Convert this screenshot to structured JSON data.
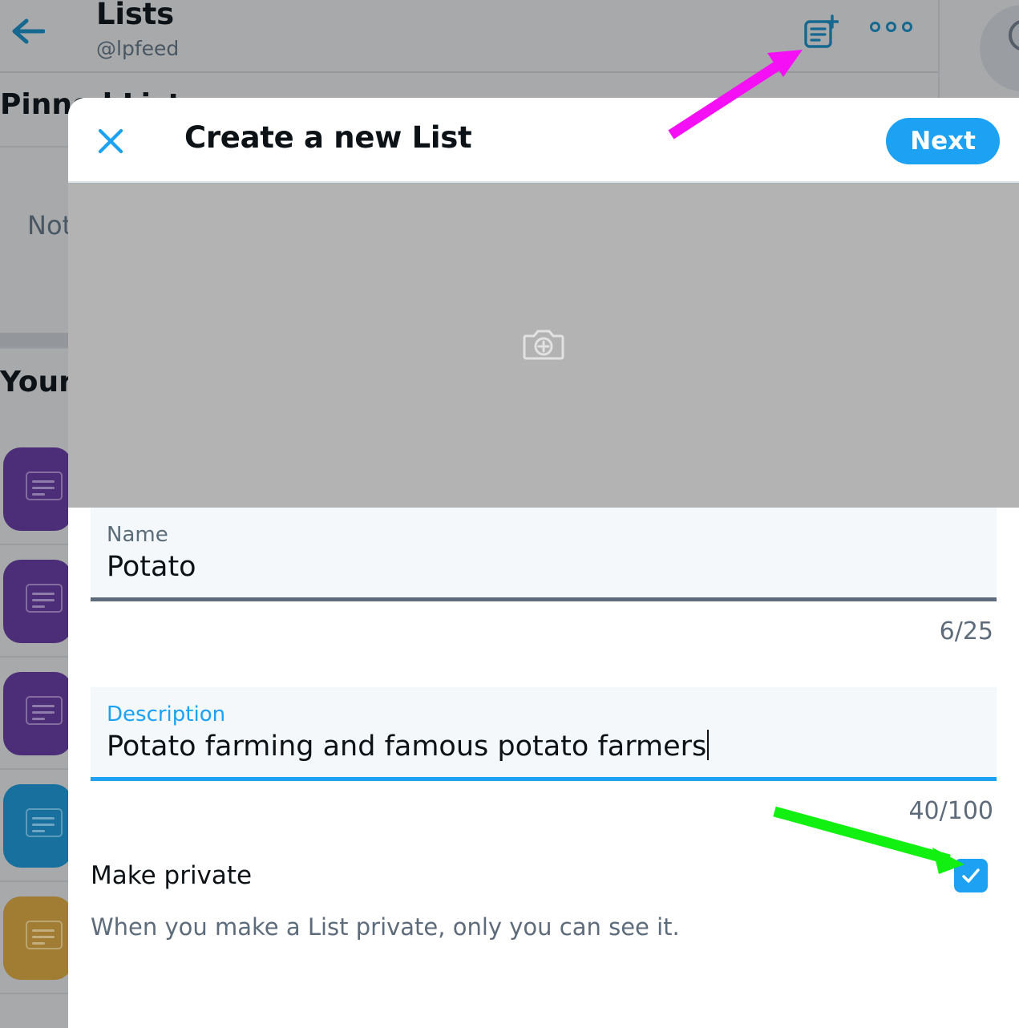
{
  "background": {
    "back_icon": "back-arrow-icon",
    "title": "Lists",
    "handle": "@lpfeed",
    "new_list_icon": "new-list-icon",
    "more_icon": "more-options-icon",
    "pinned_heading": "Pinned Lists",
    "pinned_empty": "Nothing to see here — yet",
    "your_heading": "Your Lists",
    "list_items": [
      {
        "thumb_color": "#4c2d77",
        "name": "list-thumbnail"
      },
      {
        "thumb_color": "#4c2d77",
        "name": "list-thumbnail"
      },
      {
        "thumb_color": "#4c2d77",
        "name": "list-thumbnail"
      },
      {
        "thumb_color": "#18709f",
        "name": "list-thumbnail"
      },
      {
        "thumb_color": "#a07d33",
        "name": "list-thumbnail"
      }
    ]
  },
  "modal": {
    "close_label": "×",
    "close_icon": "close-icon",
    "title": "Create a new List",
    "next_label": "Next",
    "banner": {
      "camera_icon": "camera-add-icon",
      "bg_color": "#b3b3b3"
    },
    "name_field": {
      "label": "Name",
      "value": "Potato",
      "placeholder": "Name",
      "counter": "6/25",
      "focused": false
    },
    "description_field": {
      "label": "Description",
      "value": "Potato farming and famous potato farmers",
      "placeholder": "Description",
      "counter": "40/100",
      "focused": true
    },
    "private": {
      "title": "Make private",
      "description": "When you make a List private, only you can see it.",
      "checked": true,
      "check_icon": "checkmark-icon"
    }
  },
  "annotations": [
    {
      "name": "magenta-arrow",
      "color": "#f50ff5",
      "points_to": "new-list-icon"
    },
    {
      "name": "green-arrow",
      "color": "#12f012",
      "points_to": "make-private-checkbox"
    }
  ],
  "colors": {
    "accent": "#1da1f2",
    "field_bg": "#f4f8fa",
    "muted_text": "#5d6b7a",
    "magenta": "#f50ff5",
    "green": "#12f012"
  }
}
